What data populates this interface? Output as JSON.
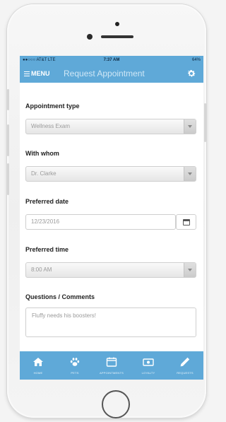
{
  "status_bar": {
    "carrier": "●●○○○ AT&T  LTE",
    "time": "7:37 AM",
    "battery": "64%"
  },
  "nav": {
    "menu_label": "MENU",
    "title": "Request Appointment",
    "settings_icon": "gear-icon"
  },
  "form": {
    "appointment_type": {
      "label": "Appointment type",
      "value": "Wellness Exam"
    },
    "with_whom": {
      "label": "With whom",
      "value": "Dr. Clarke"
    },
    "preferred_date": {
      "label": "Preferred date",
      "value": "12/23/2016"
    },
    "preferred_time": {
      "label": "Preferred time",
      "value": "8:00 AM"
    },
    "comments": {
      "label": "Questions / Comments",
      "value": "Fluffy needs his boosters!"
    }
  },
  "tabs": [
    {
      "label": "HOME",
      "icon": "home-icon"
    },
    {
      "label": "PETS",
      "icon": "paw-icon"
    },
    {
      "label": "APPOINTMENTS",
      "icon": "calendar-icon"
    },
    {
      "label": "LOYALTY",
      "icon": "ticket-icon"
    },
    {
      "label": "REQUESTS",
      "icon": "pencil-icon"
    }
  ],
  "colors": {
    "accent": "#5fa9d8"
  }
}
